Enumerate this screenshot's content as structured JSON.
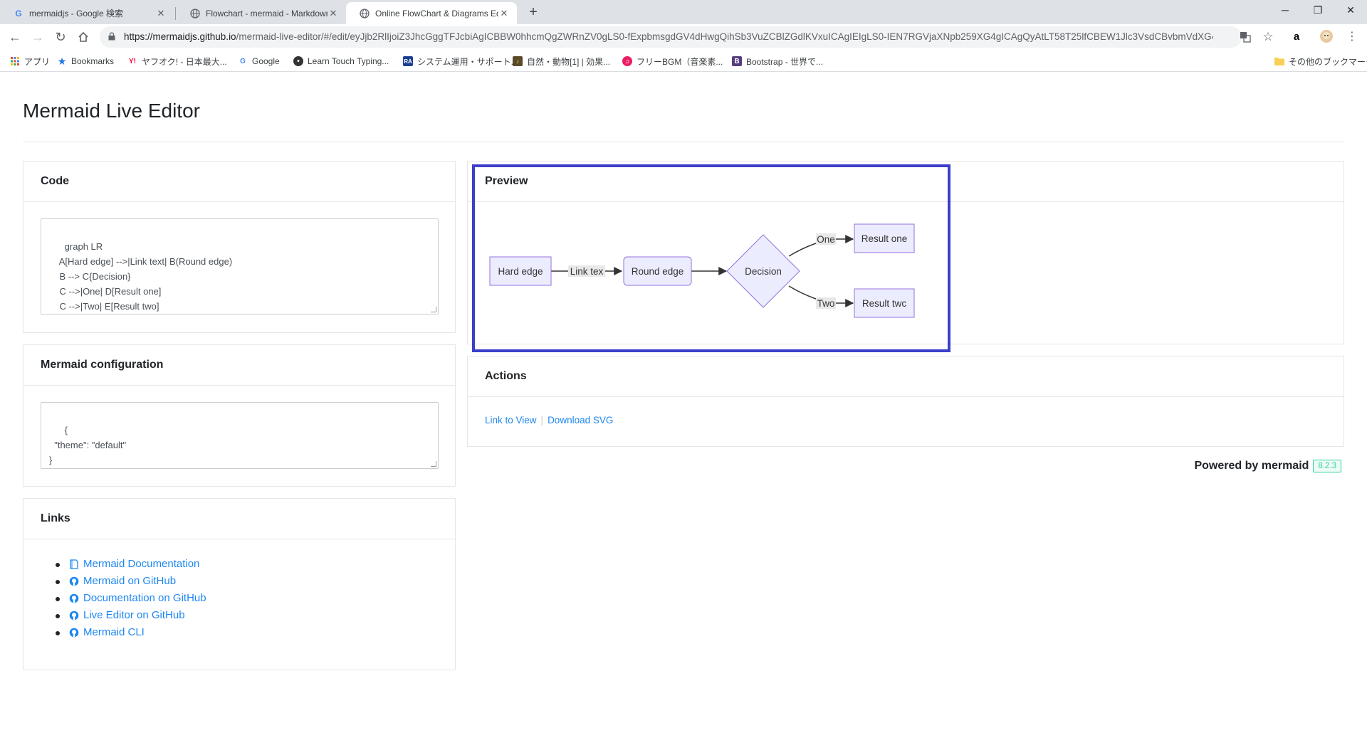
{
  "browser": {
    "tabs": [
      {
        "title": "mermaidjs - Google 検索",
        "favicon": "google-icon",
        "active": false
      },
      {
        "title": "Flowchart - mermaid - Markdown",
        "favicon": "globe-icon",
        "active": false
      },
      {
        "title": "Online FlowChart & Diagrams Ed",
        "favicon": "globe-icon",
        "active": true
      }
    ],
    "url_host": "https://mermaidjs.github.io",
    "url_path": "/mermaid-live-editor/#/edit/eyJjb2RlIjoiZ3JhcGggTFJcbiAgICBBW0hhcmQgZWRnZV0gLS0-fExpbmsgdGV4dHwgQihSb3VuZCBlZGdlKVxuICAgIEIgLS0-IEN7RGVjaXNpb259XG4gICAgQyAtLT58T25lfCBEW1Jlc3VsdCBvbmVdXG4..."
  },
  "bookmarks": [
    {
      "label": "アプリ",
      "icon": "apps-grid-icon"
    },
    {
      "label": "Bookmarks",
      "icon": "star-icon"
    },
    {
      "label": "ヤフオク! - 日本最大...",
      "icon": "yahoo-icon"
    },
    {
      "label": "Google",
      "icon": "google-icon"
    },
    {
      "label": "Learn Touch Typing...",
      "icon": "ninja-icon"
    },
    {
      "label": "システム運用・サポート...",
      "icon": "ra-icon"
    },
    {
      "label": "自然・動物[1] | 効果...",
      "icon": "sound-icon"
    },
    {
      "label": "フリーBGM（音楽素...",
      "icon": "music-icon"
    },
    {
      "label": "Bootstrap - 世界で...",
      "icon": "bootstrap-icon"
    },
    {
      "label": "その他のブックマーク",
      "icon": "folder-icon"
    }
  ],
  "page": {
    "title": "Mermaid Live Editor",
    "code_card": {
      "heading": "Code",
      "code": "graph LR\n    A[Hard edge] -->|Link text| B(Round edge)\n    B --> C{Decision}\n    C -->|One| D[Result one]\n    C -->|Two| E[Result two]"
    },
    "config_card": {
      "heading": "Mermaid configuration",
      "config": "{\n  \"theme\": \"default\"\n}"
    },
    "links_card": {
      "heading": "Links",
      "items": [
        {
          "label": "Mermaid Documentation",
          "icon": "book-icon"
        },
        {
          "label": "Mermaid on GitHub",
          "icon": "github-icon"
        },
        {
          "label": "Documentation on GitHub",
          "icon": "github-icon"
        },
        {
          "label": "Live Editor on GitHub",
          "icon": "github-icon"
        },
        {
          "label": "Mermaid CLI",
          "icon": "github-icon"
        }
      ]
    },
    "preview_card": {
      "heading": "Preview",
      "diagram": {
        "nodes": {
          "A": "Hard edge",
          "B": "Round edge",
          "C": "Decision",
          "D": "Result one",
          "E": "Result twc"
        },
        "edge_labels": {
          "A_B": "Link tex",
          "C_D": "One",
          "C_E": "Two"
        }
      }
    },
    "actions_card": {
      "heading": "Actions",
      "link_to_view": "Link to View",
      "download_svg": "Download SVG"
    },
    "powered_by": "Powered by mermaid",
    "version": "8.2.3"
  },
  "colors": {
    "accent_link": "#1e87f0",
    "node_fill": "#ececff",
    "node_stroke": "#9370db",
    "highlight_border": "#3b3fc9",
    "badge_green": "#32d296"
  }
}
